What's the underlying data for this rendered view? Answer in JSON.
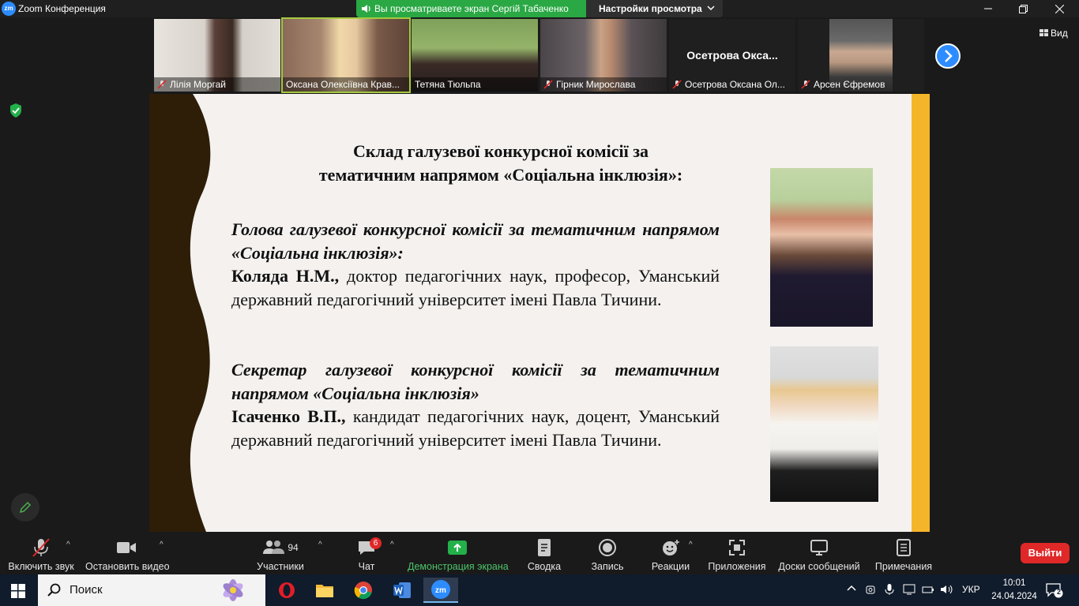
{
  "window": {
    "title": "Zoom Конференция",
    "app_logo": "zm"
  },
  "share": {
    "banner": "Вы просматриваете экран Сергій Табаченко",
    "view_options": "Настройки просмотра"
  },
  "gallery": {
    "participants": [
      {
        "name": "Лілія Моргай",
        "muted": true
      },
      {
        "name": "Оксана Олексіївна Крав...",
        "muted": false
      },
      {
        "name": "Тетяна Тюльпа",
        "muted": false
      },
      {
        "name": "Гірник Мирослава",
        "muted": true
      },
      {
        "name": "Осетрова Оксана Ол...",
        "muted": true,
        "display_name": "Осетрова  Окса..."
      },
      {
        "name": "Арсен Єфремов",
        "muted": true
      }
    ],
    "view_label": "Вид"
  },
  "slide": {
    "title_line1": "Склад галузевої конкурсної комісії за",
    "title_line2": "тематичним напрямом «Соціальна інклюзія»:",
    "head_role": "Голова галузевої конкурсної комісії за тематичним напрямом «Соціальна інклюзія»:",
    "head_name": "Коляда Н.М.,",
    "head_desc": " доктор педагогічних наук, професор, Уманський державний педагогічний університет імені Павла Тичини.",
    "secretary_role": "Секретар галузевої конкурсної комісії за тематичним напрямом «Соціальна інклюзія»",
    "secretary_name": "Ісаченко В.П.,",
    "secretary_desc": " кандидат педагогічних наук, доцент, Уманський державний педагогічний університет імені Павла Тичини."
  },
  "toolbar": {
    "audio": "Включить звук",
    "video": "Остановить видео",
    "participants": "Участники",
    "participants_count": "94",
    "chat": "Чат",
    "chat_badge": "6",
    "share": "Демонстрация экрана",
    "summary": "Сводка",
    "record": "Запись",
    "reactions": "Реакции",
    "apps": "Приложения",
    "whiteboards": "Доски сообщений",
    "notes": "Примечания",
    "leave": "Выйти"
  },
  "taskbar": {
    "search_placeholder": "Поиск",
    "language": "УКР",
    "time": "10:01",
    "date": "24.04.2024",
    "notifications": "2"
  },
  "colors": {
    "accent_blue": "#2d8cff",
    "share_green": "#2aa844",
    "leave_red": "#e02828",
    "slide_stripe": "#f5b52a",
    "slide_band": "#2e1e08"
  }
}
